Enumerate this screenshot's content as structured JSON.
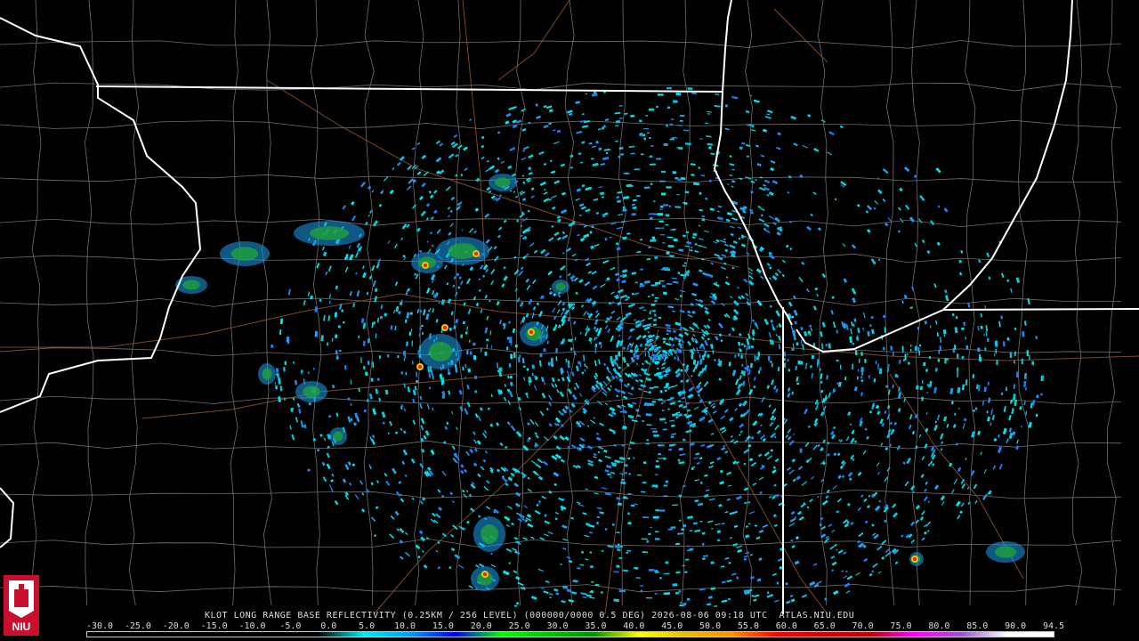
{
  "product_title": "KLOT LONG RANGE BASE REFLECTIVITY (0.25KM / 256 LEVEL) (000000/0000 0.5 DEG) 2026-08-06 09:18 UTC  ATLAS.NIU.EDU",
  "logo_text": "NIU",
  "colors": {
    "background": "#000000",
    "state_border": "#ffffff",
    "county_border": "#6e6e6e",
    "highway": "#7a4a2a",
    "light_echo": "#00c8e6",
    "moderate_echo": "#1fa03a",
    "heavy_echo": "#e6c800",
    "intense_echo": "#e61e1e"
  },
  "color_scale": {
    "labels": [
      "-30.0",
      "-25.0",
      "-20.0",
      "-15.0",
      "-10.0",
      "-5.0",
      "0.0",
      "5.0",
      "10.0",
      "15.0",
      "20.0",
      "25.0",
      "30.0",
      "35.0",
      "40.0",
      "45.0",
      "50.0",
      "55.0",
      "60.0",
      "65.0",
      "70.0",
      "75.0",
      "80.0",
      "85.0",
      "90.0",
      "94.5"
    ],
    "stops": [
      "#000000",
      "#000000",
      "#000000",
      "#000000",
      "#000000",
      "#000000",
      "#00ecec",
      "#01a0f6",
      "#0000f6",
      "#00ff00",
      "#00c800",
      "#009000",
      "#ffff00",
      "#e7c000",
      "#ff9000",
      "#ff0000",
      "#d60000",
      "#c00000",
      "#ff00ff",
      "#9955c9",
      "#ffffff",
      "#ffffff"
    ]
  }
}
